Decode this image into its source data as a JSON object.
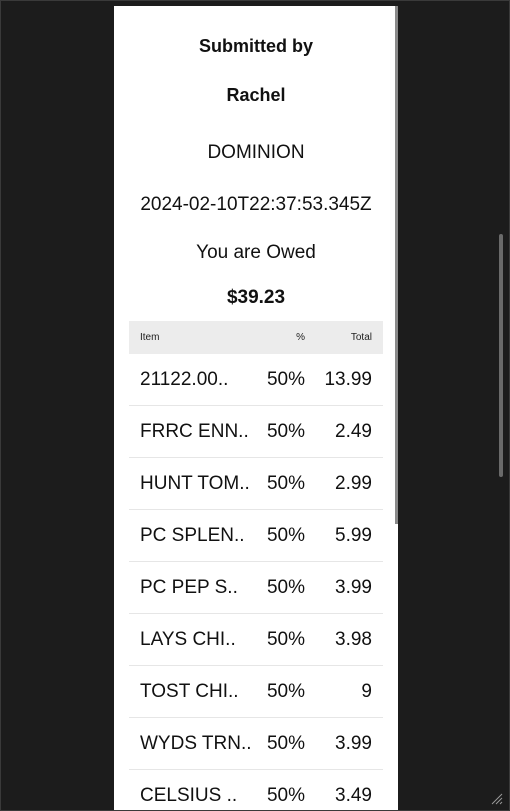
{
  "receipt": {
    "submitted_label": "Submitted by",
    "submitter": "Rachel",
    "store": "DOMINION",
    "timestamp": "2024-02-10T22:37:53.345Z",
    "owed_label": "You are Owed",
    "owed_amount": "$39.23"
  },
  "table": {
    "headers": {
      "item": "Item",
      "percent": "%",
      "total": "Total"
    },
    "rows": [
      {
        "item": "21122.00..",
        "percent": "50%",
        "total": "13.99"
      },
      {
        "item": "FRRC ENN..",
        "percent": "50%",
        "total": "2.49"
      },
      {
        "item": "HUNT TOM..",
        "percent": "50%",
        "total": "2.99"
      },
      {
        "item": "PC SPLEN..",
        "percent": "50%",
        "total": "5.99"
      },
      {
        "item": "PC PEP S..",
        "percent": "50%",
        "total": "3.99"
      },
      {
        "item": "LAYS CHI..",
        "percent": "50%",
        "total": "3.98"
      },
      {
        "item": "TOST CHI..",
        "percent": "50%",
        "total": "9"
      },
      {
        "item": "WYDS TRN..",
        "percent": "50%",
        "total": "3.99"
      },
      {
        "item": "CELSIUS ..",
        "percent": "50%",
        "total": "3.49"
      }
    ]
  },
  "colors": {
    "background": "#1c1c1c",
    "panel": "#ffffff",
    "header_row": "#ececec"
  }
}
